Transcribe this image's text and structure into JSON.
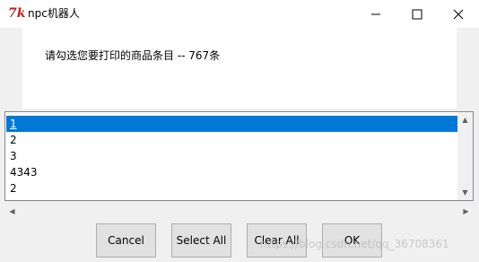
{
  "window": {
    "icon_text": "7k",
    "title": "npc机器人",
    "icons": {
      "minimize": "minimize-icon",
      "maximize": "maximize-icon",
      "close": "close-icon"
    }
  },
  "message": "请勾选您要打印的商品条目 -- 767条",
  "list": {
    "items": [
      {
        "label": "1",
        "selected": true
      },
      {
        "label": "2",
        "selected": false
      },
      {
        "label": "3",
        "selected": false
      },
      {
        "label": "4343",
        "selected": false
      },
      {
        "label": "2",
        "selected": false
      }
    ],
    "selection_color": "#0078d7"
  },
  "buttons": {
    "cancel": "Cancel",
    "select_all": "Select All",
    "clear_all": "Clear All",
    "ok": "OK"
  },
  "watermark": "https://blog.csdn.net/qq_36708361"
}
